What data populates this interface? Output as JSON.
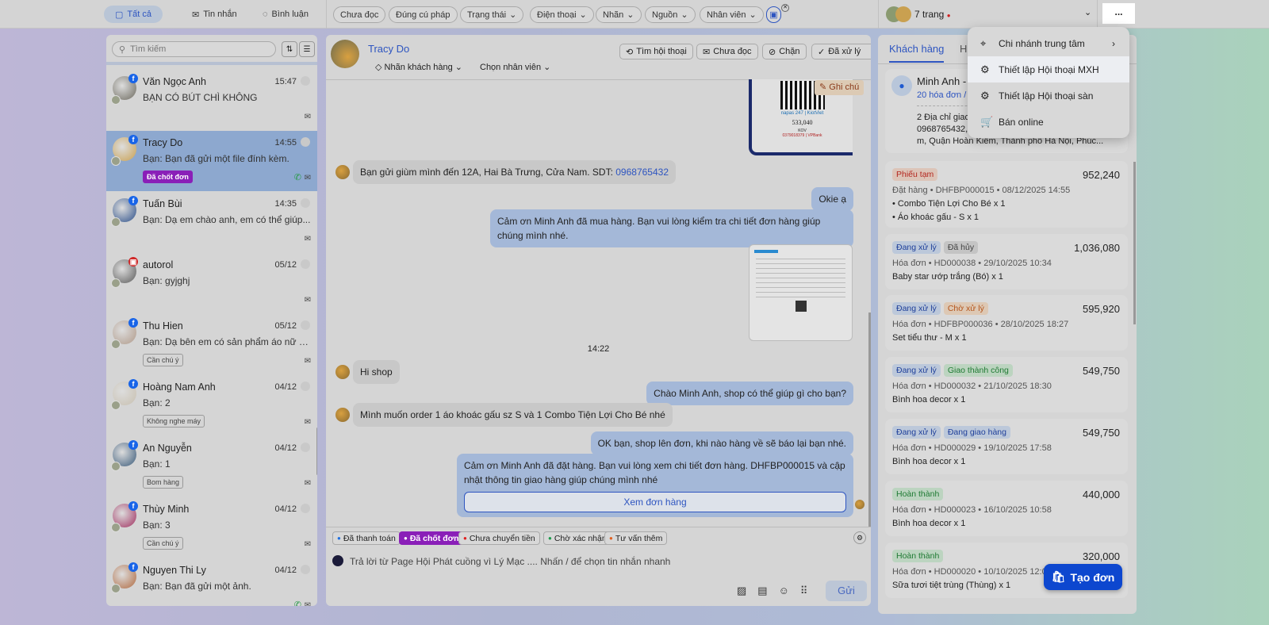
{
  "topbar": {
    "tabs": [
      {
        "icon": "chat-icon",
        "label": "Tất cả"
      },
      {
        "icon": "mail-icon",
        "label": "Tin nhắn"
      },
      {
        "icon": "comment-icon",
        "label": "Bình luận"
      }
    ],
    "filters": [
      "Chưa đọc",
      "Đúng cú pháp",
      "Trạng thái",
      "Điện thoại",
      "Nhãn",
      "Nguồn",
      "Nhân viên"
    ],
    "pages_label": "7 trang",
    "more": "..."
  },
  "sidebar": {
    "search_placeholder": "Tìm kiếm",
    "conversations": [
      {
        "name": "Văn Ngọc Anh",
        "time": "15:47",
        "preview": "BẠN CÓ BÚT CHÌ KHÔNG",
        "tag": "",
        "source": "facebook",
        "color": "#6d6a5f"
      },
      {
        "name": "Tracy Do",
        "time": "14:55",
        "preview": "Bạn: Bạn đã gửi một file đính kèm.",
        "tag": "Đã chốt đơn",
        "source": "facebook",
        "color": "#c9a050",
        "selected": true,
        "phone": true
      },
      {
        "name": "Tuấn Bùi",
        "time": "14:35",
        "preview": "Bạn: Dạ em chào anh, em có thể giúp...",
        "tag": "",
        "source": "facebook",
        "color": "#2b4f8a"
      },
      {
        "name": "autorol",
        "time": "05/12",
        "preview": "Bạn: gyjghj",
        "tag": "",
        "source": "other",
        "color": "#5a5a5a"
      },
      {
        "name": "Thu Hien",
        "time": "05/12",
        "preview": "Bạn: Dạ bên em có sản phẩm áo nữ c...",
        "tag": "Cần chú ý",
        "source": "facebook",
        "color": "#b09a8a"
      },
      {
        "name": "Hoàng Nam Anh",
        "time": "04/12",
        "preview": "Bạn: 2",
        "tag": "Không nghe máy",
        "source": "facebook",
        "color": "#c8c0b0"
      },
      {
        "name": "An Nguyễn",
        "time": "04/12",
        "preview": "Bạn: 1",
        "tag": "Bom hàng",
        "source": "facebook",
        "color": "#3a5a7a"
      },
      {
        "name": "Thùy Minh",
        "time": "04/12",
        "preview": "Bạn: 3",
        "tag": "Cần chú ý",
        "source": "facebook",
        "color": "#a03060"
      },
      {
        "name": "Nguyen Thi Ly",
        "time": "04/12",
        "preview": "Bạn: Bạn đã gửi một ảnh.",
        "tag": "",
        "source": "facebook",
        "color": "#b06a40",
        "phone": true
      }
    ]
  },
  "chat": {
    "name": "Tracy Do",
    "label_select": "Nhãn khách hàng",
    "staff_select": "Chọn nhân viên",
    "actions": [
      "Tìm hội thoại",
      "Chưa đọc",
      "Chặn",
      "Đã xử lý"
    ],
    "note": "Ghi chú",
    "qr": {
      "brand": "napas 247 | KiotViet",
      "amount": "533,040",
      "name": "KOV",
      "account": "0379018379 | VPBank"
    },
    "messages": [
      {
        "dir": "in",
        "pre": "Bạn gửi giùm mình đến 12A, Hai Bà Trưng, Cửa Nam. SDT: ",
        "link": "0968765432"
      },
      {
        "dir": "out",
        "text": "Okie ạ"
      },
      {
        "dir": "out",
        "text": "Cảm ơn Minh Anh đã mua hàng. Bạn vui lòng kiểm tra chi tiết đơn hàng giúp chúng mình nhé."
      },
      {
        "dir": "time",
        "text": "14:22"
      },
      {
        "dir": "in",
        "text": "Hi shop"
      },
      {
        "dir": "out",
        "text": "Chào Minh Anh, shop có thể giúp gì cho bạn?"
      },
      {
        "dir": "in",
        "text": "Mình muốn order 1 áo khoác gấu sz S và 1 Combo Tiện Lợi Cho Bé nhé"
      },
      {
        "dir": "out",
        "text": "OK bạn, shop lên đơn, khi nào hàng về sẽ báo lại bạn nhé."
      },
      {
        "dir": "out",
        "text": "Cảm ơn Minh Anh đã đặt hàng. Bạn vui lòng xem chi tiết đơn hàng. DHFBP000015 và cập nhật thông tin giao hàng giúp chúng mình nhé",
        "button": "Xem đơn hàng"
      }
    ],
    "quick_tags": [
      {
        "label": "Đã thanh toán",
        "color": "#1e6fe0"
      },
      {
        "label": "Đã chốt đơn",
        "color": "#ffffff",
        "active": true
      },
      {
        "label": "Chưa chuyển tiền",
        "color": "#e02020"
      },
      {
        "label": "Chờ xác nhận",
        "color": "#1a9a4a"
      },
      {
        "label": "Tư vấn thêm",
        "color": "#e06020"
      }
    ],
    "input_placeholder": "Trả lời từ Page Hội Phát cuồng vì Lý Mạc .... Nhấn / để chọn tin nhắn nhanh",
    "send": "Gửi"
  },
  "right": {
    "tabs": [
      "Khách hàng",
      "H"
    ],
    "customer": {
      "name": "Minh Anh - ",
      "invoices": "20 hóa đơn / ",
      "address_count": "2 Địa chỉ giao",
      "phone": "0968765432,",
      "address": "m, Quận Hoàn Kiếm, Thành phố Hà Nội, Phúc..."
    },
    "orders": [
      {
        "badges": [
          [
            "Phiếu tạm",
            "b-red"
          ]
        ],
        "amount": "952,240",
        "meta": "Đặt hàng • DHFBP000015 • 08/12/2025 14:55",
        "items": [
          "• Combo Tiện Lợi Cho Bé x 1",
          "• Áo khoác gấu - S x 1"
        ]
      },
      {
        "badges": [
          [
            "Đang xử lý",
            "b-blue"
          ],
          [
            "Đã hủy",
            "b-gray"
          ]
        ],
        "amount": "1,036,080",
        "meta": "Hóa đơn • HD000038 • 29/10/2025 10:34",
        "items": [
          "Baby star ướp trắng (Bó) x 1"
        ]
      },
      {
        "badges": [
          [
            "Đang xử lý",
            "b-blue"
          ],
          [
            "Chờ xử lý",
            "b-orange"
          ]
        ],
        "amount": "595,920",
        "meta": "Hóa đơn • HDFBP000036 • 28/10/2025 18:27",
        "items": [
          "Set tiểu thư - M x 1"
        ]
      },
      {
        "badges": [
          [
            "Đang xử lý",
            "b-blue"
          ],
          [
            "Giao thành công",
            "b-green"
          ]
        ],
        "amount": "549,750",
        "meta": "Hóa đơn • HD000032 • 21/10/2025 18:30",
        "items": [
          "Bình hoa decor x 1"
        ]
      },
      {
        "badges": [
          [
            "Đang xử lý",
            "b-blue"
          ],
          [
            "Đang giao hàng",
            "b-blue"
          ]
        ],
        "amount": "549,750",
        "meta": "Hóa đơn • HD000029 • 19/10/2025 17:58",
        "items": [
          "Bình hoa decor x 1"
        ]
      },
      {
        "badges": [
          [
            "Hoàn thành",
            "b-green"
          ]
        ],
        "amount": "440,000",
        "meta": "Hóa đơn • HD000023 • 16/10/2025 10:58",
        "items": [
          "Bình hoa decor x 1"
        ]
      },
      {
        "badges": [
          [
            "Hoàn thành",
            "b-green"
          ]
        ],
        "amount": "320,000",
        "meta": "Hóa đơn • HD000020 • 10/10/2025 12:00",
        "items": [
          "Sữa tươi tiệt trùng (Thùng) x 1"
        ]
      }
    ],
    "create_order": "Tạo đơn"
  },
  "menu": {
    "items": [
      {
        "icon": "location-icon",
        "label": "Chi nhánh trung tâm",
        "sub": true
      },
      {
        "icon": "gear-icon",
        "label": "Thiết lập Hội thoại MXH",
        "hl": true
      },
      {
        "icon": "gear-icon",
        "label": "Thiết lập Hội thoại sàn"
      },
      {
        "icon": "cart-icon",
        "label": "Bán online"
      }
    ]
  }
}
